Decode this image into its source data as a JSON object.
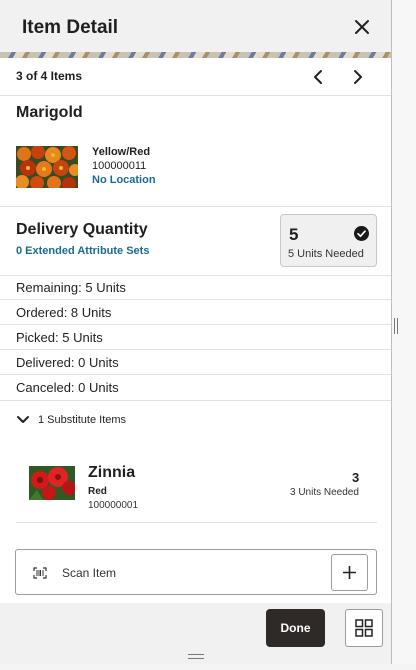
{
  "header": {
    "title": "Item Detail",
    "close_icon": "close-icon"
  },
  "pager": {
    "count_text": "3 of 4 Items",
    "prev_icon": "chevron-left-icon",
    "next_icon": "chevron-right-icon"
  },
  "item": {
    "name": "Marigold",
    "color": "Yellow/Red",
    "sku": "100000011",
    "location": "No Location"
  },
  "delivery": {
    "title": "Delivery Quantity",
    "attribute_link": "0 Extended Attribute Sets",
    "quantity": "5",
    "needed": "5 Units Needed",
    "status_icon": "check-circle-icon"
  },
  "stats": {
    "remaining": "Remaining: 5 Units",
    "ordered": "Ordered: 8 Units",
    "picked": "Picked: 5 Units",
    "delivered": "Delivered: 0 Units",
    "canceled": "Canceled: 0 Units"
  },
  "substitutes": {
    "toggle_label": "1 Substitute Items",
    "toggle_icon": "chevron-down-icon",
    "items": [
      {
        "name": "Zinnia",
        "color": "Red",
        "sku": "100000001",
        "quantity": "3",
        "needed": "3 Units Needed"
      }
    ]
  },
  "scan": {
    "label": "Scan Item",
    "scan_icon": "barcode-scan-icon",
    "add_icon": "plus-icon"
  },
  "footer": {
    "done_label": "Done",
    "grid_icon": "grid-icon"
  },
  "colors": {
    "link": "#1a6b8f",
    "done_bg": "#2f2a28",
    "header_bg": "#f1f1f1"
  }
}
